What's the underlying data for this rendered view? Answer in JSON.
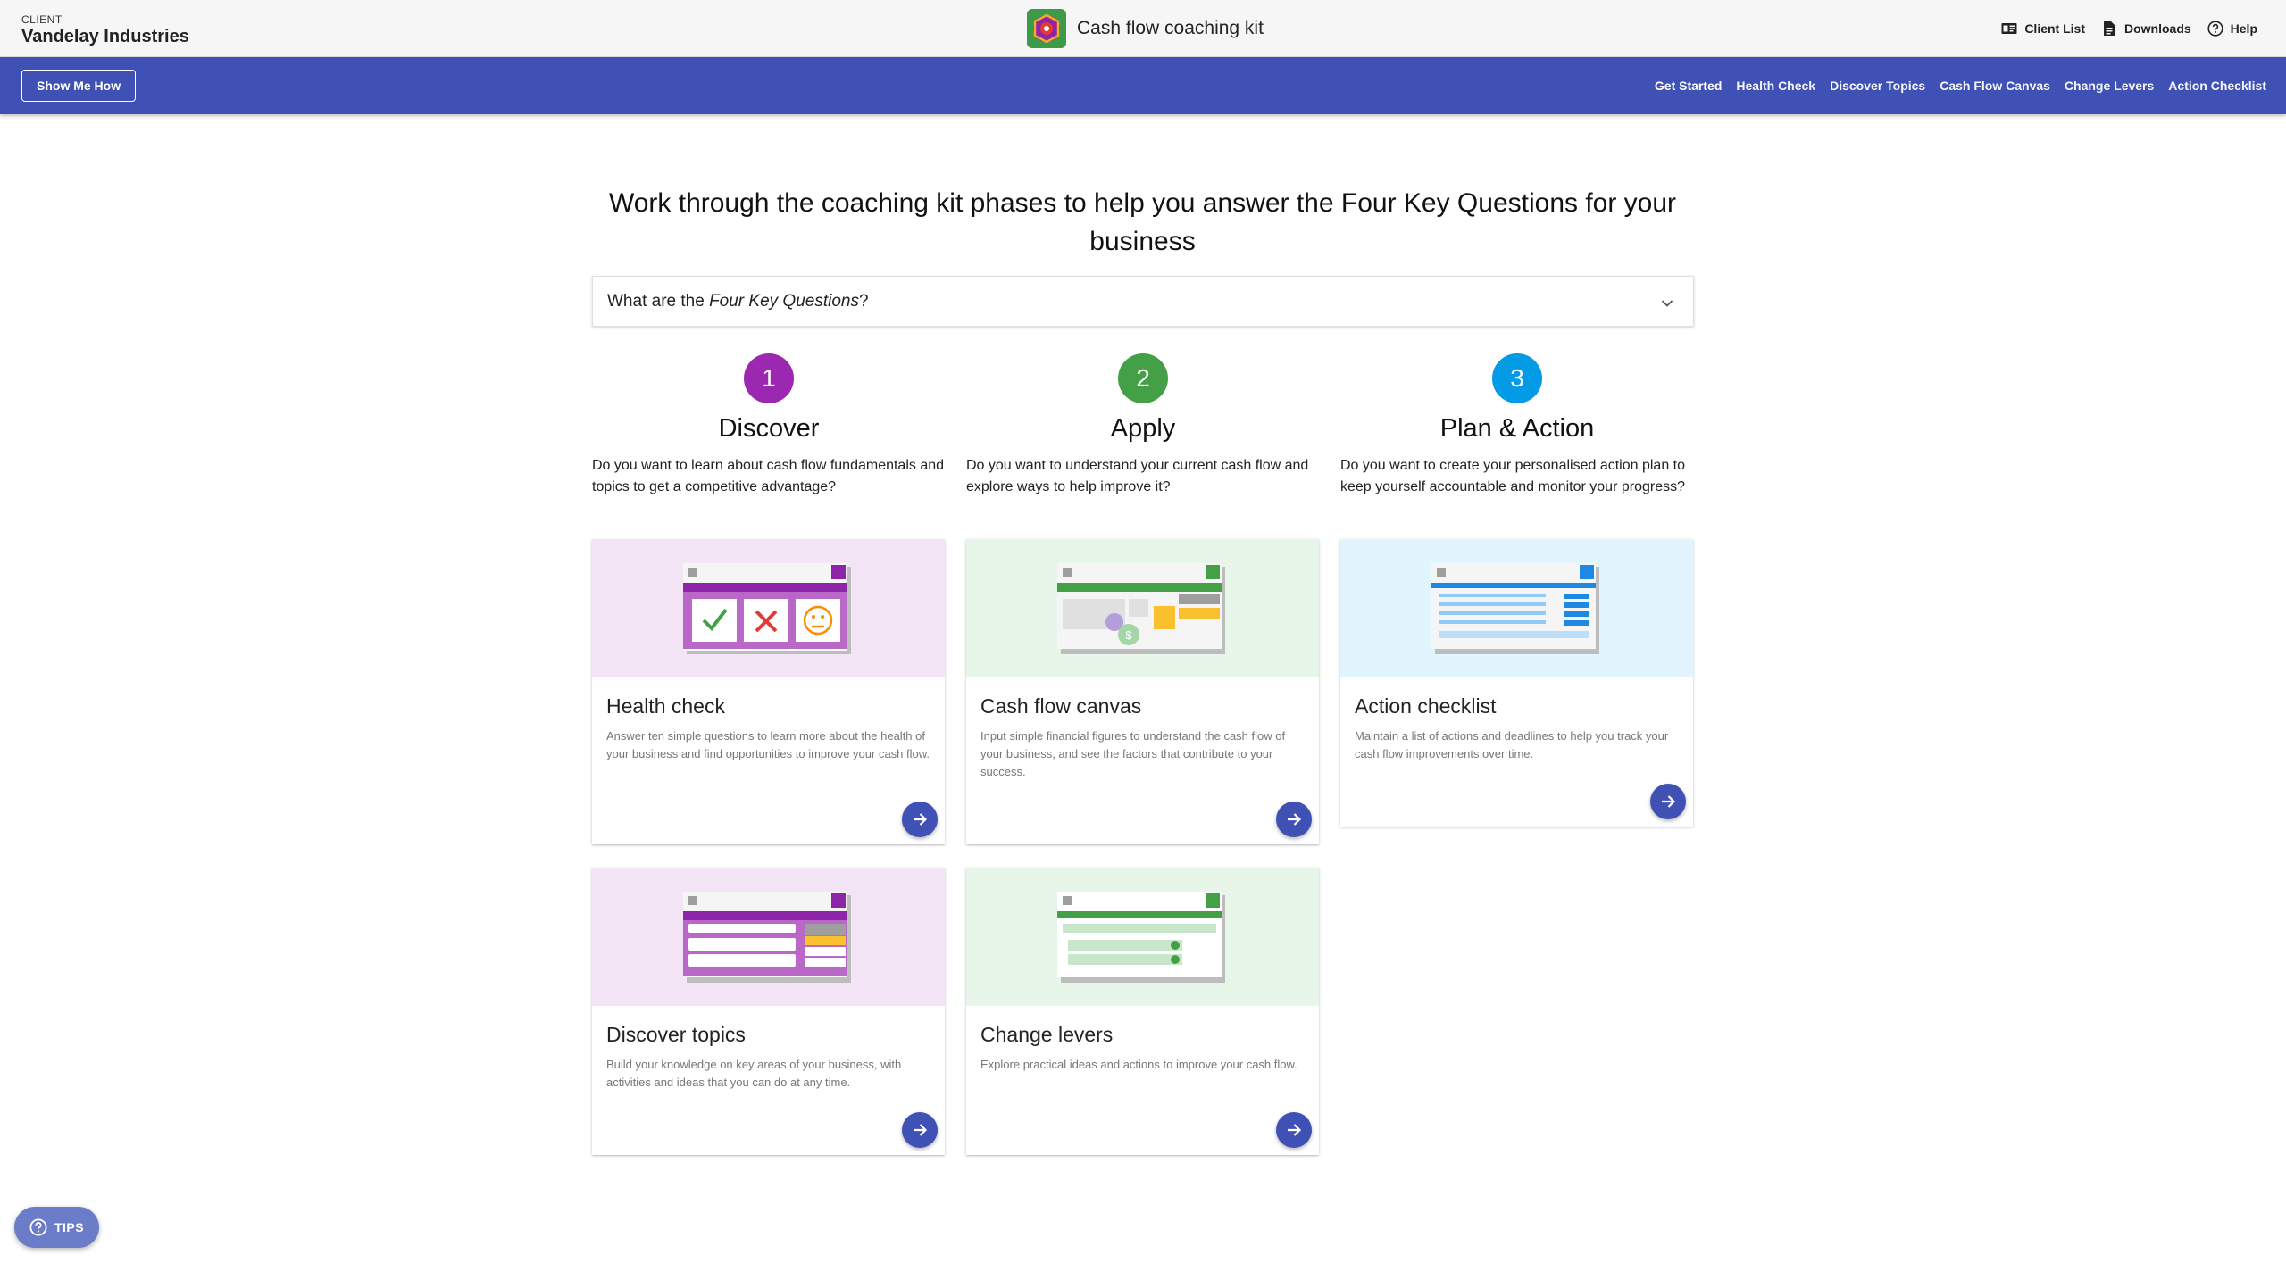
{
  "client": {
    "label": "CLIENT",
    "name": "Vandelay Industries"
  },
  "app": {
    "title": "Cash flow coaching kit"
  },
  "top_actions": [
    {
      "label": "Client List",
      "icon": "client-list-icon"
    },
    {
      "label": "Downloads",
      "icon": "document-icon"
    },
    {
      "label": "Help",
      "icon": "help-icon"
    }
  ],
  "navbar": {
    "show_me_how": "Show Me How",
    "items": [
      "Get Started",
      "Health Check",
      "Discover Topics",
      "Cash Flow Canvas",
      "Change Levers",
      "Action Checklist"
    ],
    "active": "Get Started"
  },
  "headline": "Work through the coaching kit phases to help you answer the Four Key Questions for your business",
  "accordion": {
    "prefix": "What are the ",
    "emphasis": "Four Key Questions",
    "suffix": "?"
  },
  "phases": [
    {
      "number": "1",
      "title": "Discover",
      "color": "#9c27b0",
      "description": "Do you want to learn about cash flow fundamentals and topics to get a competitive advantage?"
    },
    {
      "number": "2",
      "title": "Apply",
      "color": "#43a047",
      "description": "Do you want to understand your current cash flow and explore ways to help improve it?"
    },
    {
      "number": "3",
      "title": "Plan & Action",
      "color": "#039be5",
      "description": "Do you want to create your personalised action plan to keep yourself accountable and monitor your progress?"
    }
  ],
  "cards": [
    {
      "title": "Health check",
      "description": "Answer ten simple questions to learn more about the health of your business and find opportunities to improve your cash flow.",
      "bg": "#f3e5f5"
    },
    {
      "title": "Cash flow canvas",
      "description": "Input simple financial figures to understand the cash flow of your business, and see the factors that contribute to your success.",
      "bg": "#e8f5e9"
    },
    {
      "title": "Action checklist",
      "description": "Maintain a list of actions and deadlines to help you track your cash flow improvements over time.",
      "bg": "#e1f5fe"
    },
    {
      "title": "Discover topics",
      "description": "Build your knowledge on key areas of your business, with activities and ideas that you can do at any time.",
      "bg": "#f3e5f5"
    },
    {
      "title": "Change levers",
      "description": "Explore practical ideas and actions to improve your cash flow.",
      "bg": "#e8f5e9"
    }
  ],
  "tips": {
    "label": "TIPS"
  },
  "colors": {
    "primary": "#3f51b5",
    "purple": "#9c27b0",
    "green": "#43a047",
    "blue": "#039be5"
  }
}
